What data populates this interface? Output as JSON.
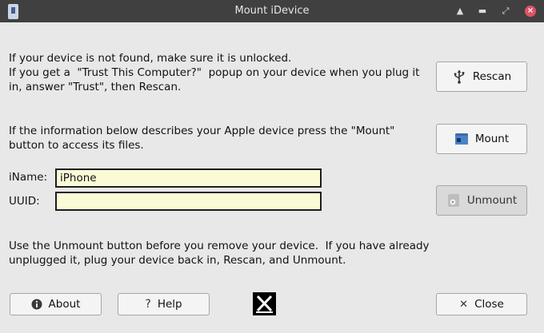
{
  "window": {
    "title": "Mount iDevice",
    "titlebar_icons": [
      "app-icon",
      "shade-icon",
      "minimize-icon",
      "maximize-icon",
      "close-icon"
    ]
  },
  "messages": {
    "not_found_line1": "If your device is not found, make sure it is unlocked.",
    "not_found_line2": "If you get a  \"Trust This Computer?\"  popup on your device when you plug it",
    "not_found_line3": "in, answer \"Trust\", then Rescan.",
    "info_line1": "If the information below describes your Apple device press the \"Mount\"",
    "info_line2": "button to access its files.",
    "unmount_line1": "Use the Unmount button before you remove your device.  If you have already",
    "unmount_line2": "unplugged it, plug your device back in, Rescan, and Unmount."
  },
  "fields": {
    "iname_label": "iName:",
    "iname_value": "iPhone",
    "uuid_label": "UUID:",
    "uuid_value": ""
  },
  "buttons": {
    "rescan": "Rescan",
    "mount": "Mount",
    "unmount": "Unmount",
    "about": "About",
    "help": "Help",
    "close": "Close"
  },
  "colors": {
    "field_bg": "#fbfad6",
    "close_dot": "#e05363",
    "titlebar": "#404040"
  }
}
